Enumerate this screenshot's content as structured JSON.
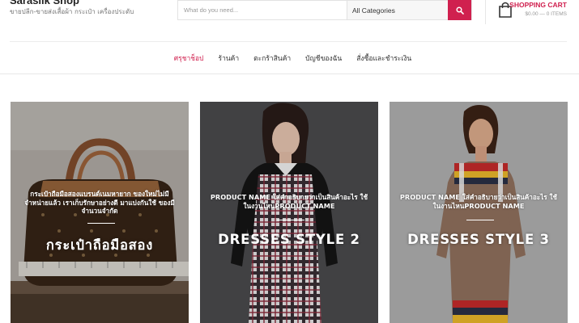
{
  "brand": {
    "title": "Sarasilk Shop",
    "tagline": "ขายปลีก-ขายส่งเสื้อผ้า กระเป๋า เครื่องประดับ"
  },
  "search": {
    "placeholder": "What do you need...",
    "category_selected": "All Categories",
    "button_icon": "search-icon"
  },
  "cart": {
    "title": "SHOPPING CART",
    "summary": "$0.00 — 0 ITEMS",
    "icon": "shopping-bag-icon"
  },
  "nav": {
    "items": [
      {
        "label": "ศรุชาช็อป",
        "active": true
      },
      {
        "label": "ร้านค้า",
        "active": false
      },
      {
        "label": "ตะกร้าสินค้า",
        "active": false
      },
      {
        "label": "บัญชีของฉัน",
        "active": false
      },
      {
        "label": "สั่งซื้อและชำระเงิน",
        "active": false
      }
    ]
  },
  "cards": [
    {
      "description": "กระเป๋าถือมือสองแบรนด์เนมหายาก ของใหม่ไม่มีจำหน่ายแล้ว เราเก็บรักษาอย่างดี มาแบ่งกันใช้ ของมีจำนวนจำกัด",
      "title": "กระเป๋าถือมือสอง"
    },
    {
      "description": "PRODUCT NAME ใส่คำอธิบายว่าเป็นสินค้าอะไร ใช้ในงานไหนPRODUCT NAME",
      "title": "DRESSES STYLE 2"
    },
    {
      "description": "PRODUCT NAME ใส่คำอธิบายว่าเป็นสินค้าอะไร ใช้ในงานไหนPRODUCT NAME",
      "title": "DRESSES STYLE 3"
    }
  ],
  "colors": {
    "accent": "#d0204f",
    "text": "#333333",
    "muted": "#999999"
  }
}
